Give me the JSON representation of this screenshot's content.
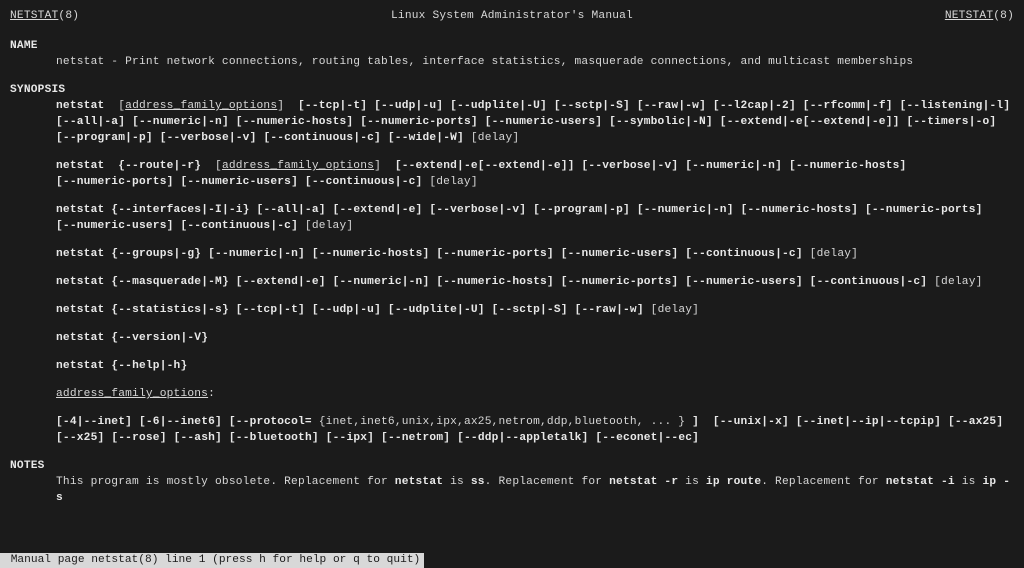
{
  "header": {
    "ref_left": "NETSTAT",
    "ref_left_num": "(8)",
    "title": "Linux System Administrator's Manual",
    "ref_right": "NETSTAT",
    "ref_right_num": "(8)"
  },
  "sections": {
    "name_label": "NAME",
    "name_text": "netstat - Print network connections, routing tables, interface statistics, masquerade connections, and multicast memberships",
    "synopsis_label": "SYNOPSIS",
    "notes_label": "NOTES",
    "afo_label": "address_family_options",
    "afo_colon": ":"
  },
  "syn": {
    "cmd": "netstat",
    "afo_link": "address_family_options",
    "delay": "[delay]",
    "l1_flags": [
      "[--tcp|-t]",
      "[--udp|-u]",
      "[--udplite|-U]",
      "[--sctp|-S]",
      "[--raw|-w]",
      "[--l2cap|-2]",
      "[--rfcomm|-f]",
      "[--listening|-l]",
      "[--all|-a]",
      "[--numeric|-n]",
      "[--numeric-hosts]",
      "[--numeric-ports]",
      "[--numeric-users]",
      "[--symbolic|-N]",
      "[--extend|-e[--extend|-e]]",
      "[--timers|-o]",
      "[--program|-p]",
      "[--verbose|-v]",
      "[--continuous|-c]",
      "[--wide|-W]"
    ],
    "l2_open": "{--route|-r}",
    "l2_flags": [
      "[--extend|-e[--extend|-e]]",
      "[--verbose|-v]",
      "[--numeric|-n]",
      "[--numeric-hosts]",
      "[--numeric-ports]",
      "[--numeric-users]",
      "[--continuous|-c]"
    ],
    "l3_open": "{--interfaces|-I|-i}",
    "l3_flags": [
      "[--all|-a]",
      "[--extend|-e]",
      "[--verbose|-v]",
      "[--program|-p]",
      "[--numeric|-n]",
      "[--numeric-hosts]",
      "[--numeric-ports]",
      "[--numeric-users]",
      "[--continuous|-c]"
    ],
    "l4_open": "{--groups|-g}",
    "l4_flags": [
      "[--numeric|-n]",
      "[--numeric-hosts]",
      "[--numeric-ports]",
      "[--numeric-users]",
      "[--continuous|-c]"
    ],
    "l5_open": "{--masquerade|-M}",
    "l5_flags": [
      "[--extend|-e]",
      "[--numeric|-n]",
      "[--numeric-hosts]",
      "[--numeric-ports]",
      "[--numeric-users]",
      "[--continuous|-c]"
    ],
    "l6_open": "{--statistics|-s}",
    "l6_flags": [
      "[--tcp|-t]",
      "[--udp|-u]",
      "[--udplite|-U]",
      "[--sctp|-S]",
      "[--raw|-w]"
    ],
    "l7_open": "{--version|-V}",
    "l8_open": "{--help|-h}",
    "afo_l1": [
      "[-4|--inet]",
      "[-6|--inet6]",
      "[--protocol="
    ],
    "afo_proto": "{inet,inet6,unix,ipx,ax25,netrom,ddp,bluetooth, ... }",
    "afo_close": "]",
    "afo_l1b": [
      "[--unix|-x]",
      "[--inet|--ip|--tcpip]",
      "[--ax25]",
      "[--x25]",
      "[--rose]",
      "[--ash]",
      "[--bluetooth]",
      "[--ipx]",
      "[--netrom]",
      "[--ddp|--appletalk]",
      "[--econet|--ec]"
    ]
  },
  "notes": {
    "t1": "This program is mostly obsolete.  Replacement for ",
    "b1": "netstat",
    "t2": " is ",
    "b2": "ss",
    "t3": ".  Replacement for ",
    "b3": "netstat -r",
    "t4": " is ",
    "b4": "ip route",
    "t5": ".  Replacement for ",
    "b5": "netstat -i",
    "t6": " is ",
    "b6": "ip -s"
  },
  "status": " Manual page netstat(8) line 1 (press h for help or q to quit)"
}
